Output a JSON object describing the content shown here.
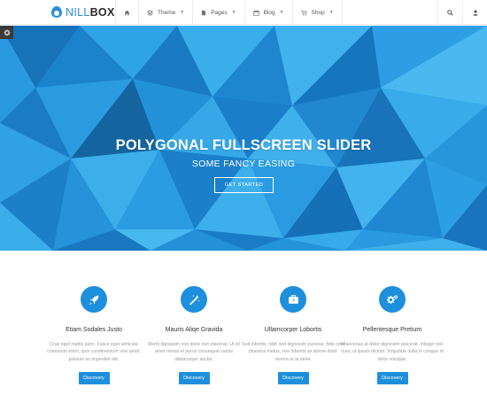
{
  "brand": {
    "name_light": "NILL",
    "name_bold": "BOX"
  },
  "nav": {
    "items": [
      {
        "label": "Theme",
        "icon": "layers-icon"
      },
      {
        "label": "Pages",
        "icon": "file-icon"
      },
      {
        "label": "Blog",
        "icon": "calendar-icon"
      },
      {
        "label": "Shop",
        "icon": "cart-icon"
      }
    ],
    "home_icon": "home-icon",
    "search_icon": "search-icon",
    "user_icon": "user-icon"
  },
  "hero": {
    "title": "POLYGONAL FULLSCREEN SLIDER",
    "subtitle": "SOME FANCY EASING",
    "button": "GET STARTED"
  },
  "features": [
    {
      "title": "Etiam Sodales Justo",
      "icon": "rocket-icon",
      "text": "Cras eget mattis justo. Fusce eget vehicula commodo enim, quis condimentum vive amet, pretium ex imperdiet elit.",
      "button": "Discovery"
    },
    {
      "title": "Mauris Aliqe Gravida",
      "icon": "magic-wand-icon",
      "text": "Morbi dignissim non dolor non placerat. Ut sit amet metus et purus consequat varius ullamcorper auctor.",
      "button": "Discovery"
    },
    {
      "title": "Ullamcorper Lobortis",
      "icon": "briefcase-icon",
      "text": "Sed lobortis, nibh sed dignissim pulvinar, felis odio pharetra metus, non lobortis se dolore dolor viverra et at amet.",
      "button": "Discovery"
    },
    {
      "title": "Pellentesque Pretium",
      "icon": "gears-icon",
      "text": "Maecenas at dolor dignissim placerat. Integer nisl nunc ut ipsum dictum. Vulputate nulla in congue id dolor volutpat.",
      "button": "Discovery"
    }
  ],
  "colors": {
    "accent": "#1e8fdc",
    "hero": "#1e8fd8"
  }
}
